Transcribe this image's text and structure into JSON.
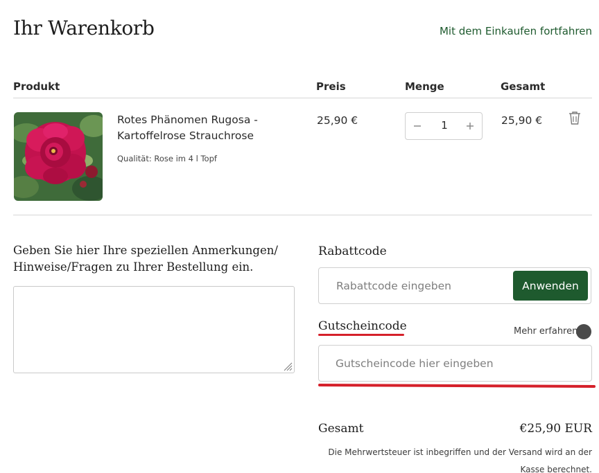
{
  "header": {
    "title": "Ihr Warenkorb",
    "continue_label": "Mit dem Einkaufen fortfahren"
  },
  "table": {
    "headers": {
      "product": "Produkt",
      "price": "Preis",
      "quantity": "Menge",
      "total": "Gesamt"
    }
  },
  "cart": {
    "items": [
      {
        "name": "Rotes Phänomen Rugosa - Kartoffelrose Strauchrose",
        "variant": "Qualität: Rose im 4 l Topf",
        "price": "25,90 €",
        "quantity": "1",
        "total": "25,90 €"
      }
    ]
  },
  "notes": {
    "label": "Geben Sie hier Ihre speziellen Anmerkungen/ Hinweise/Fragen zu Ihrer Bestellung ein."
  },
  "discount": {
    "label": "Rabattcode",
    "placeholder": "Rabattcode eingeben",
    "apply_label": "Anwenden"
  },
  "voucher": {
    "label": "Gutscheincode",
    "more_label": "Mehr erfahren",
    "placeholder": "Gutscheincode hier eingeben"
  },
  "summary": {
    "total_label": "Gesamt",
    "total_value": "€25,90 EUR",
    "tax_note": "Die Mehrwertsteuer ist inbegriffen und der Versand wird an der Kasse berechnet."
  },
  "colors": {
    "brand_green": "#1e5a2e",
    "annotation_red": "#d5202a"
  },
  "icons": [
    "minus-icon",
    "plus-icon",
    "trash-icon",
    "info-dot-icon",
    "resize-grip-icon"
  ]
}
